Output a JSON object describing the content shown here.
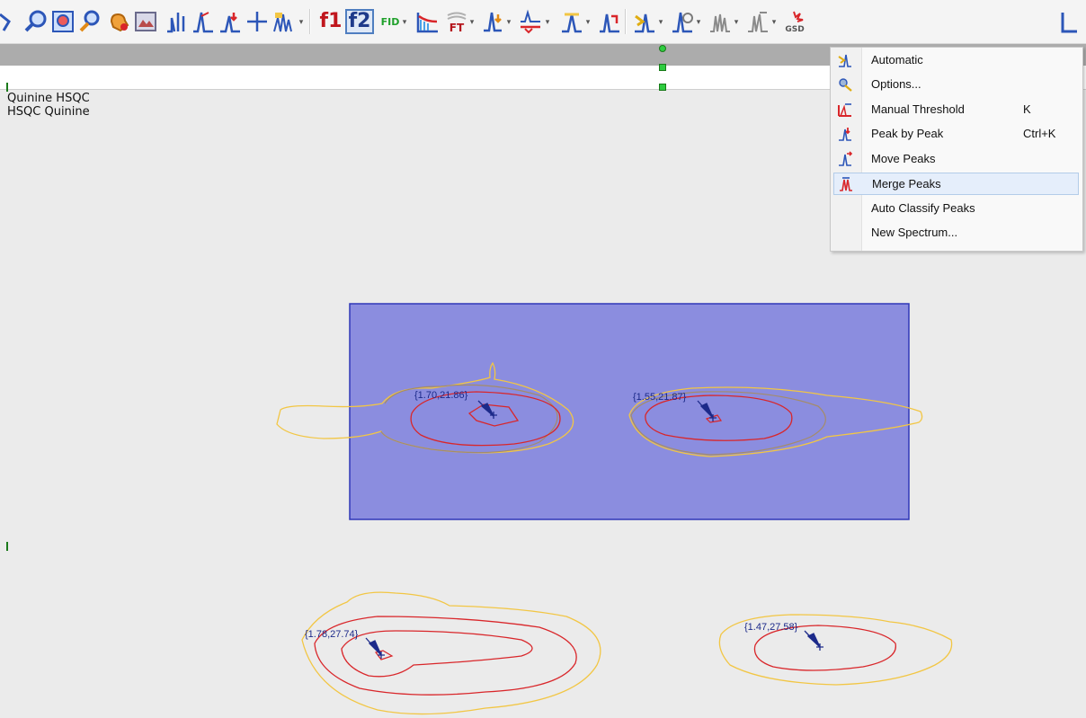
{
  "toolbar": {
    "f1_label": "f1",
    "f2_label": "f2",
    "fid_label": "FID",
    "ft_label": "FT",
    "gsd_label": "GSD"
  },
  "spectrum": {
    "title_line1": "Quinine HSQC",
    "title_line2": "HSQC Quinine"
  },
  "peaks": [
    {
      "label": "{1.70,21.86}"
    },
    {
      "label": "{1.55,21.87}"
    },
    {
      "label": "{1.78,27.74}"
    },
    {
      "label": "{1.47,27.58}"
    }
  ],
  "menu": {
    "items": [
      {
        "label": "Automatic",
        "shortcut": "",
        "icon": "auto-peak-icon"
      },
      {
        "label": "Options...",
        "shortcut": "",
        "icon": "peak-options-icon"
      },
      {
        "label": "Manual Threshold",
        "shortcut": "K",
        "icon": "manual-threshold-icon"
      },
      {
        "label": "Peak by Peak",
        "shortcut": "Ctrl+K",
        "icon": "peak-by-peak-icon"
      },
      {
        "label": "Move Peaks",
        "shortcut": "",
        "icon": "move-peaks-icon"
      },
      {
        "label": "Merge Peaks",
        "shortcut": "",
        "icon": "merge-peaks-icon",
        "highlighted": true
      },
      {
        "label": "Auto Classify Peaks",
        "shortcut": "",
        "icon": ""
      },
      {
        "label": "New Spectrum...",
        "shortcut": "",
        "icon": ""
      }
    ]
  },
  "colors": {
    "selection_fill": "#8b8ddf",
    "selection_border": "#2f37b8",
    "contour_outer": "#f2c644",
    "contour_inner": "#d9262a",
    "peak_marker": "#1c2a8a"
  }
}
